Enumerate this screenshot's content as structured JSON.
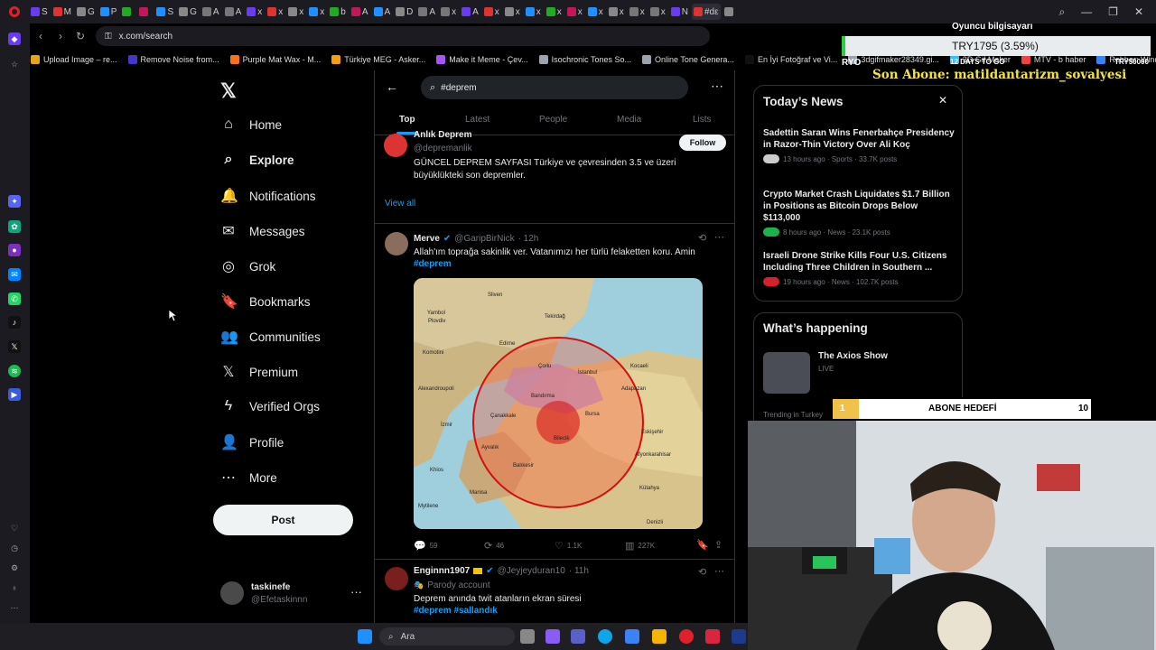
{
  "browser": {
    "tabs": [
      "S",
      "M",
      "G",
      "P",
      "",
      "",
      "S",
      "G",
      "A",
      "A",
      "x",
      "x",
      "x",
      "x",
      "b",
      "A",
      "A",
      "D",
      "A",
      "x",
      "A",
      "x",
      "x",
      "x",
      "x",
      "x",
      "x",
      "x",
      "x",
      "x",
      "N",
      "#dε",
      ""
    ],
    "url": "x.com/search",
    "bookmarks": [
      "Upload Image – re...",
      "Remove Noise from...",
      "Purple Mat Wax - M...",
      "Türkiye MEG - Asker...",
      "Make it Meme - Çev...",
      "Isochronic Tones So...",
      "Online Tone Genera...",
      "En İyi Fotoğraf ve Vi...",
      "3dgifmaker28349.gi...",
      "3D Gif Maker",
      "MTV - b haber",
      "Rehber: Windows 1..."
    ]
  },
  "nav": {
    "items": [
      {
        "label": "Home",
        "icon": "home-icon",
        "glyph": "⌂"
      },
      {
        "label": "Explore",
        "icon": "search-icon",
        "glyph": "⌕"
      },
      {
        "label": "Notifications",
        "icon": "bell-icon",
        "glyph": "🔔"
      },
      {
        "label": "Messages",
        "icon": "mail-icon",
        "glyph": "✉"
      },
      {
        "label": "Grok",
        "icon": "grok-icon",
        "glyph": "◎"
      },
      {
        "label": "Bookmarks",
        "icon": "bookmark-icon",
        "glyph": "🔖"
      },
      {
        "label": "Communities",
        "icon": "people-icon",
        "glyph": "👥"
      },
      {
        "label": "Premium",
        "icon": "x-premium-icon",
        "glyph": "𝕏"
      },
      {
        "label": "Verified Orgs",
        "icon": "lightning-icon",
        "glyph": "ϟ"
      },
      {
        "label": "Profile",
        "icon": "person-icon",
        "glyph": "👤"
      },
      {
        "label": "More",
        "icon": "more-circle-icon",
        "glyph": "⋯"
      }
    ],
    "post_label": "Post",
    "account": {
      "name": "taskinefe",
      "handle": "@Efetaskinnn"
    }
  },
  "search": {
    "query": "#deprem",
    "tabs": [
      "Top",
      "Latest",
      "People",
      "Media",
      "Lists"
    ],
    "active_tab": "Top"
  },
  "people_result": {
    "name": "Anlık Deprem",
    "handle": "@depremanlik",
    "follow_label": "Follow",
    "bio": "GÜNCEL DEPREM SAYFASI Türkiye ve çevresinden 3.5 ve üzeri büyüklükteki son depremler.",
    "view_all": "View all"
  },
  "tweet1": {
    "name": "Merve",
    "handle": "@GaripBirNick",
    "time": "· 12h",
    "text": "Allah'ım toprağa sakinlik ver. Vatanımızı her türlü felaketten koru. Amin",
    "hashtag": "#deprem",
    "map_labels": [
      "Sliven",
      "Yambol",
      "Plovdiv",
      "Edirne",
      "Tekirdağ",
      "Çorlu",
      "İstanbul",
      "Kocaeli",
      "Çanakkale",
      "Bandırma",
      "Bursa",
      "Adapazarı",
      "Bilecik",
      "Eskişehir",
      "Balıkesir",
      "Ayvalık",
      "Manisa",
      "İzmir",
      "Kütahya",
      "Afyonkarahisar",
      "Denizli",
      "Mytilene",
      "Khios",
      "Komotini",
      "Alexandroupoli"
    ],
    "replies": "59",
    "reposts": "46",
    "likes": "1.1K",
    "views": "227K"
  },
  "tweet2": {
    "name": "Enginnn1907",
    "handle": "@Jeyjeyduran10",
    "time": "· 11h",
    "badge": "Parody account",
    "text": "Deprem anında twit atanların ekran süresi",
    "hashtags": "#deprem #sallandık"
  },
  "news": {
    "title": "Today’s News",
    "items": [
      {
        "title": "Sadettin Saran Wins Fenerbahçe Presidency in Razor-Thin Victory Over Ali Koç",
        "meta": "13 hours ago · Sports · 33.7K posts"
      },
      {
        "title": "Crypto Market Crash Liquidates $1.7 Billion in Positions as Bitcoin Drops Below $113,000",
        "meta": "8 hours ago · News · 23.1K posts"
      },
      {
        "title": "Israeli Drone Strike Kills Four U.S. Citizens Including Three Children in Southern ...",
        "meta": "19 hours ago · News · 102.7K posts"
      }
    ]
  },
  "happening": {
    "title": "What’s happening",
    "show_title": "The Axios Show",
    "show_status": "LIVE",
    "trend_meta": "Trending in Turkey"
  },
  "stream": {
    "ticker_top": "Oyuncu bilgisayarı",
    "ticker_value": "TRY1795 (3.59%)",
    "ticker_left": "RYO",
    "ticker_mid": "12 DAYS TO GO",
    "ticker_right": "TRY50000",
    "last_sub": "Son Abone: matildantarizm_sovalyesi",
    "goal_current": "1",
    "goal_label": "ABONE HEDEFİ",
    "goal_target": "10",
    "goal_progress": 0.1
  },
  "taskbar": {
    "search_placeholder": "Ara"
  },
  "colors": {
    "accent": "#1d9bf0",
    "bg": "#000000",
    "border": "#2f3336",
    "muted": "#71767b",
    "sub_yellow": "#f3e43c"
  }
}
